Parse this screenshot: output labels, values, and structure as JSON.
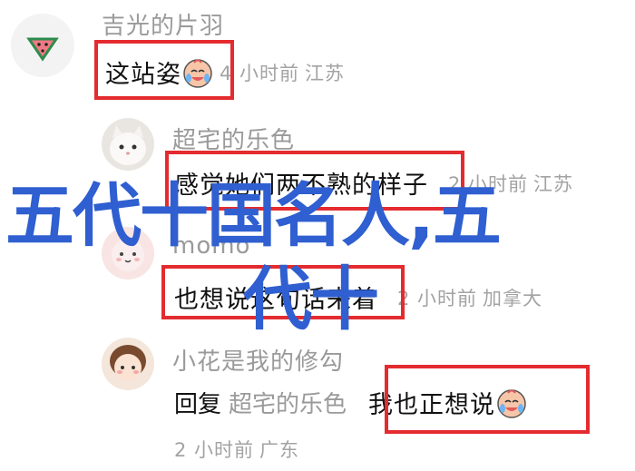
{
  "comments": [
    {
      "username": "吉光的片羽",
      "text": "这站姿",
      "time": "4 小时前",
      "location": "江苏",
      "emoji_icon": "crying-laugh-icon"
    },
    {
      "username": "超宅的乐色",
      "text": "感觉她们两不熟的样子",
      "time": "2 小时前",
      "location": "江苏"
    },
    {
      "username": "momo",
      "text": "也想说这句话来着",
      "time": "2 小时前",
      "location": "加拿大"
    },
    {
      "username": "小花是我的修勾",
      "reply_prefix": "回复",
      "reply_to": "超宅的乐色",
      "text": "我也正想说",
      "time": "2 小时前",
      "location": "广东",
      "emoji_icon": "crying-laugh-icon"
    }
  ],
  "overlay": {
    "line1": "五代十国名人,五",
    "line2": "代十"
  },
  "colors": {
    "highlight": "#e42b2f",
    "overlay_text": "#2f5fd0",
    "meta_text": "#a3a3a3"
  }
}
